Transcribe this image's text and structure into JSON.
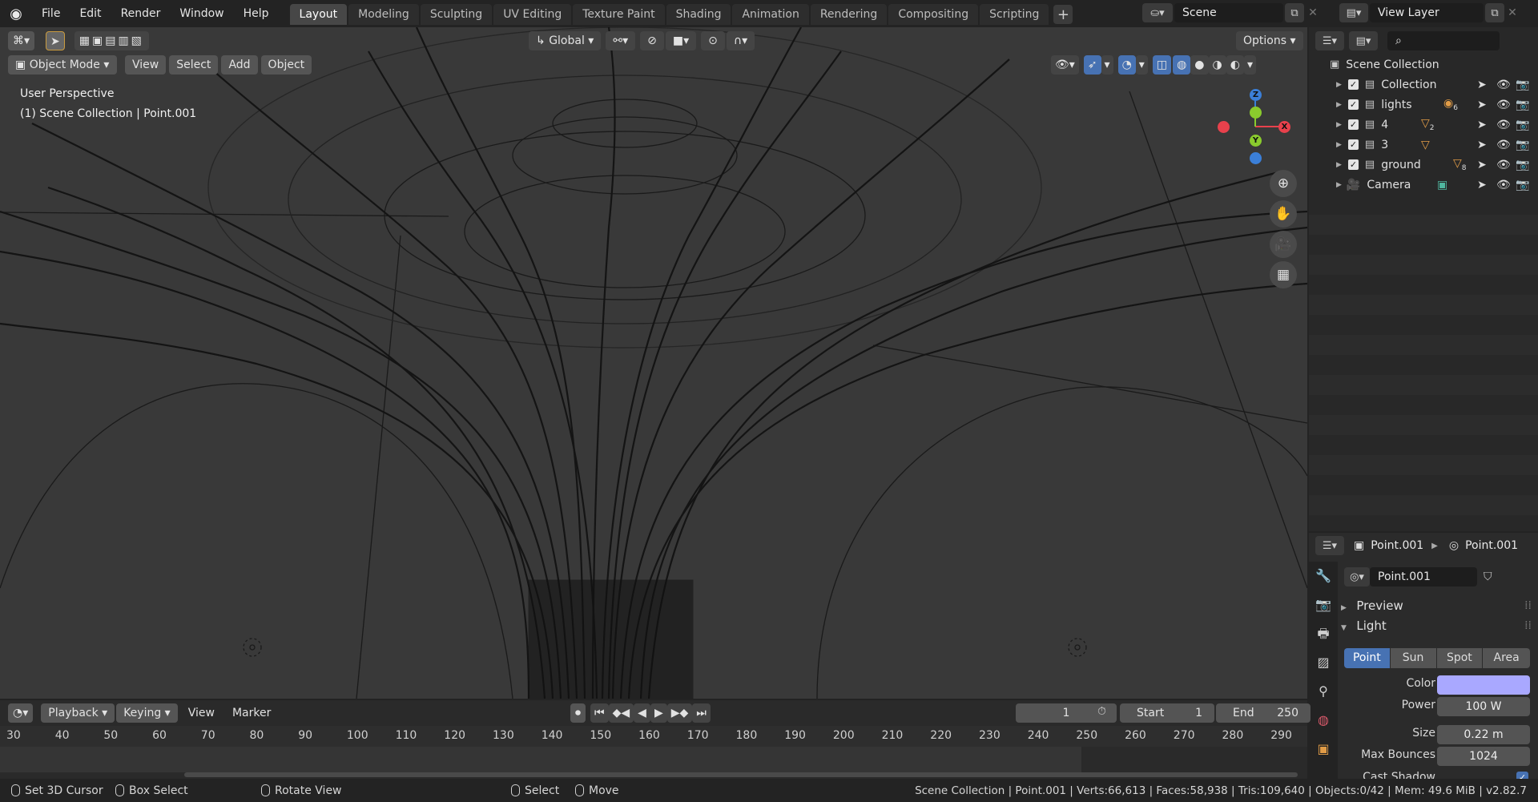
{
  "topbar": {
    "menus": [
      "File",
      "Edit",
      "Render",
      "Window",
      "Help"
    ],
    "workspaces": [
      "Layout",
      "Modeling",
      "Sculpting",
      "UV Editing",
      "Texture Paint",
      "Shading",
      "Animation",
      "Rendering",
      "Compositing",
      "Scripting"
    ],
    "active_workspace": "Layout",
    "add_tab_label": "+",
    "scene_name": "Scene",
    "view_layer_name": "View Layer"
  },
  "viewport": {
    "transform_orientation": "Global",
    "options_label": "Options",
    "mode_label": "Object Mode",
    "menus": [
      "View",
      "Select",
      "Add",
      "Object"
    ],
    "perspective_label": "User Perspective",
    "context_label": "(1) Scene Collection | Point.001",
    "gizmo_axes": {
      "z": "Z",
      "y": "Y",
      "x": "X"
    },
    "colors": {
      "x_axis": "#e8414c",
      "y_axis": "#8acb2d",
      "z_axis": "#3b7fd8",
      "background": "#393939",
      "wire": "#161616"
    }
  },
  "outliner": {
    "root_label": "Scene Collection",
    "items": [
      {
        "label": "Collection",
        "badge": ""
      },
      {
        "label": "lights",
        "badge": "6"
      },
      {
        "label": "4",
        "badge": "2"
      },
      {
        "label": "3",
        "badge": ""
      },
      {
        "label": "ground",
        "badge": "8"
      },
      {
        "label": "Camera",
        "badge": ""
      }
    ]
  },
  "properties": {
    "breadcrumb_object": "Point.001",
    "breadcrumb_data": "Point.001",
    "data_name": "Point.001",
    "panels": {
      "preview": "Preview",
      "light": "Light"
    },
    "light_types": [
      "Point",
      "Sun",
      "Spot",
      "Area"
    ],
    "active_light_type": "Point",
    "color_label": "Color",
    "color_value": "#a9a8ff",
    "power_label": "Power",
    "power_value": "100 W",
    "size_label": "Size",
    "size_value": "0.22 m",
    "max_bounces_label": "Max Bounces",
    "max_bounces_value": "1024",
    "cast_shadow_label": "Cast Shadow"
  },
  "timeline": {
    "menus": [
      "Playback",
      "Keying",
      "View",
      "Marker"
    ],
    "current_frame": "1",
    "start_label": "Start",
    "start_value": "1",
    "end_label": "End",
    "end_value": "250",
    "ticks": [
      "30",
      "40",
      "50",
      "60",
      "70",
      "80",
      "90",
      "100",
      "110",
      "120",
      "130",
      "140",
      "150",
      "160",
      "170",
      "180",
      "190",
      "200",
      "210",
      "220",
      "230",
      "240",
      "250",
      "260",
      "270",
      "280",
      "290"
    ]
  },
  "statusbar": {
    "hints": [
      {
        "label": "Set 3D Cursor"
      },
      {
        "label": "Box Select"
      },
      {
        "label": "Rotate View"
      },
      {
        "label": "Select"
      },
      {
        "label": "Move"
      }
    ],
    "stats": "Scene Collection | Point.001 | Verts:66,613 | Faces:58,938 | Tris:109,640 | Objects:0/42 | Mem: 49.6 MiB | v2.82.7"
  }
}
